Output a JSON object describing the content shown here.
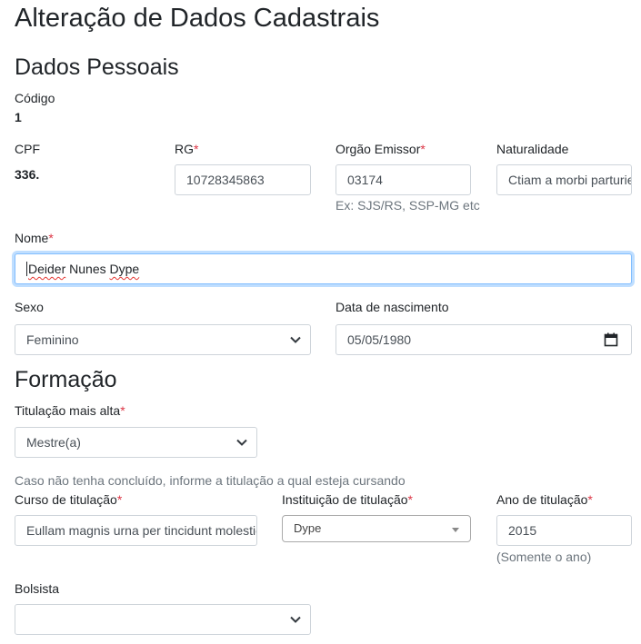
{
  "page_title": "Alteração de Dados Cadastrais",
  "sections": {
    "personal": "Dados Pessoais",
    "education": "Formação"
  },
  "required_mark": "*",
  "codigo": {
    "label": "Código",
    "value": "1"
  },
  "cpf": {
    "label": "CPF",
    "value": "336."
  },
  "rg": {
    "label": "RG",
    "value": "10728345863"
  },
  "orgao": {
    "label": "Orgão Emissor",
    "value": "03174",
    "help": "Ex: SJS/RS, SSP-MG etc"
  },
  "naturalidade": {
    "label": "Naturalidade",
    "value": "Ctiam a morbi parturient"
  },
  "nome": {
    "label": "Nome",
    "value_words": [
      "Deider",
      "Nunes",
      "Dype"
    ]
  },
  "sexo": {
    "label": "Sexo",
    "value": "Feminino"
  },
  "nascimento": {
    "label": "Data de nascimento",
    "value": "05/05/1980"
  },
  "titulacao": {
    "label": "Titulação mais alta",
    "value": "Mestre(a)",
    "note": "Caso não tenha concluído, informe a titulação a qual esteja cursando"
  },
  "curso": {
    "label": "Curso de titulação",
    "value": "Eullam magnis urna per tincidunt molestie"
  },
  "instituicao": {
    "label": "Instituição de titulação",
    "value": "Dype"
  },
  "ano": {
    "label": "Ano de titulação",
    "value": "2015",
    "help": "(Somente o ano)"
  },
  "bolsista": {
    "label": "Bolsista",
    "value": ""
  }
}
